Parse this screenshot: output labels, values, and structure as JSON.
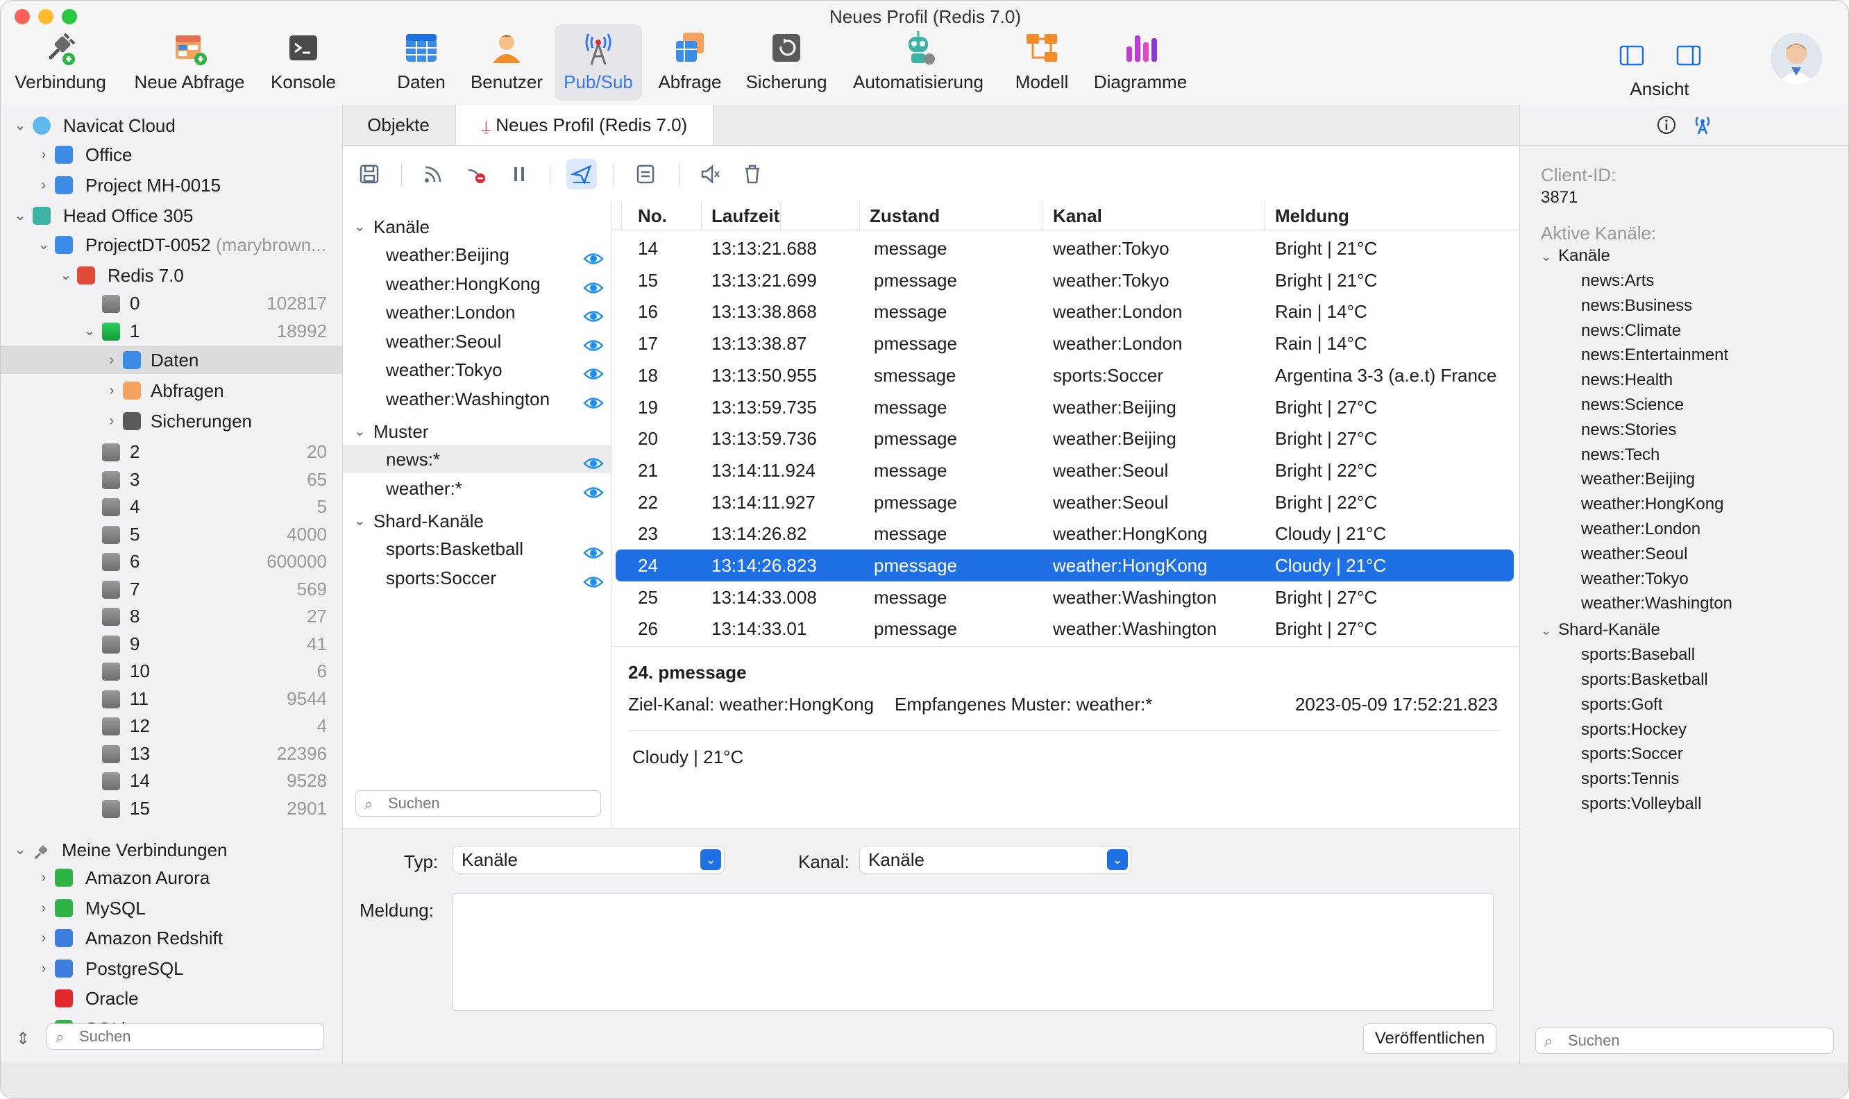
{
  "window": {
    "title": "Neues Profil (Redis 7.0)"
  },
  "toolbar": {
    "items": [
      {
        "label": "Verbindung",
        "icon": "plug-icon"
      },
      {
        "label": "Neue Abfrage",
        "icon": "new-query-icon"
      },
      {
        "label": "Konsole",
        "icon": "console-icon"
      },
      {
        "label": "Daten",
        "icon": "table-icon"
      },
      {
        "label": "Benutzer",
        "icon": "user-icon"
      },
      {
        "label": "Pub/Sub",
        "icon": "antenna-icon"
      },
      {
        "label": "Abfrage",
        "icon": "query-icon"
      },
      {
        "label": "Sicherung",
        "icon": "backup-icon"
      },
      {
        "label": "Automatisierung",
        "icon": "robot-icon"
      },
      {
        "label": "Modell",
        "icon": "model-icon"
      },
      {
        "label": "Diagramme",
        "icon": "chart-icon"
      }
    ],
    "view_label": "Ansicht"
  },
  "sidebar": {
    "cloud": "Navicat Cloud",
    "office": "Office",
    "project_mh": "Project MH-0015",
    "head_office": "Head Office 305",
    "project_dt": "ProjectDT-0052",
    "project_dt_owner": "(marybrown...",
    "redis": "Redis 7.0",
    "db0": {
      "name": "0",
      "count": "102817"
    },
    "db1": {
      "name": "1",
      "count": "18992"
    },
    "daten": "Daten",
    "abfragen": "Abfragen",
    "sicherungen": "Sicherungen",
    "dbs": [
      {
        "name": "2",
        "count": "20"
      },
      {
        "name": "3",
        "count": "65"
      },
      {
        "name": "4",
        "count": "5"
      },
      {
        "name": "5",
        "count": "4000"
      },
      {
        "name": "6",
        "count": "600000"
      },
      {
        "name": "7",
        "count": "569"
      },
      {
        "name": "8",
        "count": "27"
      },
      {
        "name": "9",
        "count": "41"
      },
      {
        "name": "10",
        "count": "6"
      },
      {
        "name": "11",
        "count": "9544"
      },
      {
        "name": "12",
        "count": "4"
      },
      {
        "name": "13",
        "count": "22396"
      },
      {
        "name": "14",
        "count": "9528"
      },
      {
        "name": "15",
        "count": "2901"
      }
    ],
    "my_connections": "Meine Verbindungen",
    "connections": [
      {
        "name": "Amazon Aurora",
        "color": "#2fb344"
      },
      {
        "name": "MySQL",
        "color": "#2fb344"
      },
      {
        "name": "Amazon Redshift",
        "color": "#3f7fe0"
      },
      {
        "name": "PostgreSQL",
        "color": "#3f7fe0"
      },
      {
        "name": "Oracle",
        "color": "#e0282e"
      },
      {
        "name": "SQLite",
        "color": "#2fb344"
      }
    ],
    "search_placeholder": "Suchen"
  },
  "tabs": {
    "objects": "Objekte",
    "profile": "Neues Profil (Redis 7.0)"
  },
  "channels": {
    "kanale_header": "Kanäle",
    "kanale": [
      "weather:Beijing",
      "weather:HongKong",
      "weather:London",
      "weather:Seoul",
      "weather:Tokyo",
      "weather:Washington"
    ],
    "muster_header": "Muster",
    "muster": [
      "news:*",
      "weather:*"
    ],
    "shard_header": "Shard-Kanäle",
    "shard": [
      "sports:Basketball",
      "sports:Soccer"
    ],
    "search_placeholder": "Suchen"
  },
  "table": {
    "headers": {
      "no": "No.",
      "time": "Laufzeit",
      "state": "Zustand",
      "channel": "Kanal",
      "message": "Meldung"
    },
    "rows": [
      {
        "no": "14",
        "time": "13:13:21.688",
        "state": "message",
        "channel": "weather:Tokyo",
        "message": "Bright | 21°C"
      },
      {
        "no": "15",
        "time": "13:13:21.699",
        "state": "pmessage",
        "channel": "weather:Tokyo",
        "message": "Bright | 21°C"
      },
      {
        "no": "16",
        "time": "13:13:38.868",
        "state": "message",
        "channel": "weather:London",
        "message": "Rain | 14°C"
      },
      {
        "no": "17",
        "time": "13:13:38.87",
        "state": "pmessage",
        "channel": "weather:London",
        "message": "Rain | 14°C"
      },
      {
        "no": "18",
        "time": "13:13:50.955",
        "state": "smessage",
        "channel": "sports:Soccer",
        "message": "Argentina 3-3 (a.e.t) France"
      },
      {
        "no": "19",
        "time": "13:13:59.735",
        "state": "message",
        "channel": "weather:Beijing",
        "message": "Bright | 27°C"
      },
      {
        "no": "20",
        "time": "13:13:59.736",
        "state": "pmessage",
        "channel": "weather:Beijing",
        "message": "Bright | 27°C"
      },
      {
        "no": "21",
        "time": "13:14:11.924",
        "state": "message",
        "channel": "weather:Seoul",
        "message": "Bright | 22°C"
      },
      {
        "no": "22",
        "time": "13:14:11.927",
        "state": "pmessage",
        "channel": "weather:Seoul",
        "message": "Bright | 22°C"
      },
      {
        "no": "23",
        "time": "13:14:26.82",
        "state": "message",
        "channel": "weather:HongKong",
        "message": "Cloudy | 21°C"
      },
      {
        "no": "24",
        "time": "13:14:26.823",
        "state": "pmessage",
        "channel": "weather:HongKong",
        "message": "Cloudy | 21°C"
      },
      {
        "no": "25",
        "time": "13:14:33.008",
        "state": "message",
        "channel": "weather:Washington",
        "message": "Bright | 27°C"
      },
      {
        "no": "26",
        "time": "13:14:33.01",
        "state": "pmessage",
        "channel": "weather:Washington",
        "message": "Bright | 27°C"
      }
    ]
  },
  "detail": {
    "title": "24. pmessage",
    "target": "Ziel-Kanal: weather:HongKong",
    "pattern": "Empfangenes Muster: weather:*",
    "timestamp": "2023-05-09 17:52:21.823",
    "body": "Cloudy | 21°C"
  },
  "publish": {
    "type_label": "Typ:",
    "type_value": "Kanäle",
    "channel_label": "Kanal:",
    "channel_value": "Kanäle",
    "message_label": "Meldung:",
    "message_value": "",
    "button": "Veröffentlichen"
  },
  "info_panel": {
    "client_id_label": "Client-ID:",
    "client_id": "3871",
    "active_label": "Aktive Kanäle:",
    "kanale_header": "Kanäle",
    "kanale": [
      "news:Arts",
      "news:Business",
      "news:Climate",
      "news:Entertainment",
      "news:Health",
      "news:Science",
      "news:Stories",
      "news:Tech",
      "weather:Beijing",
      "weather:HongKong",
      "weather:London",
      "weather:Seoul",
      "weather:Tokyo",
      "weather:Washington"
    ],
    "shard_header": "Shard-Kanäle",
    "shard": [
      "sports:Baseball",
      "sports:Basketball",
      "sports:Goft",
      "sports:Hockey",
      "sports:Soccer",
      "sports:Tennis",
      "sports:Volleyball"
    ],
    "search_placeholder": "Suchen"
  },
  "colors": {
    "accent": "#1f6fe5",
    "sidebar_bg": "#f2f2f4"
  }
}
